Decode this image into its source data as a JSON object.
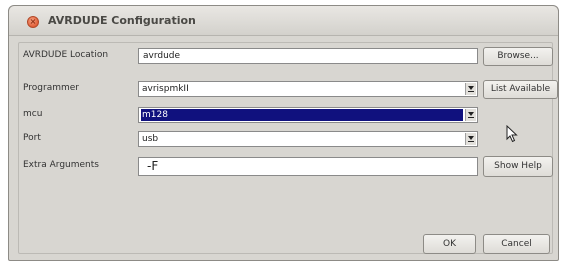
{
  "window": {
    "title": "AVRDUDE Configuration",
    "close_glyph": "×"
  },
  "form": {
    "avrdude_location": {
      "label": "AVRDUDE Location",
      "value": "avrdude",
      "browse_label": "Browse..."
    },
    "programmer": {
      "label": "Programmer",
      "value": "avrispmkII",
      "list_label": "List Available"
    },
    "mcu": {
      "label": "mcu",
      "value": "m128"
    },
    "port": {
      "label": "Port",
      "value": "usb"
    },
    "extra_arguments": {
      "label": "Extra Arguments",
      "value": "-F",
      "help_label": "Show Help"
    }
  },
  "footer": {
    "ok_label": "OK",
    "cancel_label": "Cancel"
  },
  "icons": {
    "close": "close-icon",
    "dropdown": "chevron-down-icon",
    "cursor": "mouse-pointer-icon"
  },
  "colors": {
    "selection": "#10117e",
    "close_button": "#e2603a",
    "window_bg": "#d8d6d1"
  }
}
